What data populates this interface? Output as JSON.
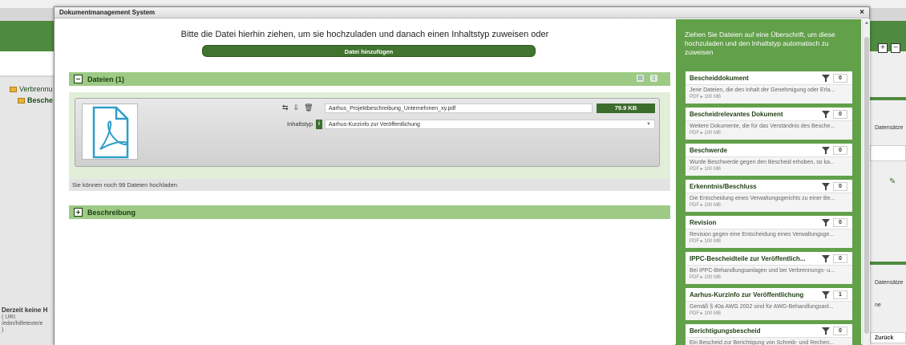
{
  "background": {
    "tree": [
      "Verbrennu",
      "Besche"
    ],
    "footer_title": "Derzeit keine H",
    "footer_lines": [
      "( URI:",
      "/edm/hilfetexte/e",
      ")"
    ],
    "right_labels": [
      "Datensätze",
      "Datensätze",
      "ne",
      "Zurück"
    ]
  },
  "dialog": {
    "title": "Dokumentmanagement System",
    "close": "×"
  },
  "upload": {
    "hint": "Bitte die Datei hierhin ziehen, um sie hochzuladen und danach einen Inhaltstyp zuweisen oder",
    "add_button": "Datei hinzufügen"
  },
  "files_section": {
    "title": "Dateien (1)",
    "file": {
      "name": "Aarhus_Projektbeschreibung_Unternehmen_xy.pdf",
      "size": "79.9 KB",
      "type_label": "Inhaltstyp",
      "type_badge": "i",
      "type_value": "Aarhus-Kurzinfo zur Veröffentlichung"
    },
    "remaining": "Sie können noch 99 Dateien hochladen"
  },
  "description_section": {
    "title": "Beschreibung"
  },
  "sidebar": {
    "hint": "Ziehen Sie Dateien auf eine Überschrift, um diese hochzuladen und den Inhaltstyp automatisch zu zuweisen",
    "items": [
      {
        "title": "Bescheiddokument",
        "count": "0",
        "desc": "Jene Dateien, die den Inhalt der Genehmigung oder Erla...",
        "meta": "PDF ▸ 100 MB"
      },
      {
        "title": "Bescheidrelevantes Dokument",
        "count": "0",
        "desc": "Weitere Dokumente, die für das Verständnis des Besche...",
        "meta": "PDF ▸ 100 MB"
      },
      {
        "title": "Beschwerde",
        "count": "0",
        "desc": "Wurde Beschwerde gegen den Bescheid erhoben, so ka...",
        "meta": "PDF ▸ 100 MB"
      },
      {
        "title": "Erkenntnis/Beschluss",
        "count": "0",
        "desc": "Die Entscheidung eines Verwaltungsgerichts zu einer Be...",
        "meta": "PDF ▸ 100 MB"
      },
      {
        "title": "Revision",
        "count": "0",
        "desc": "Revision gegen eine Entscheidung eines Verwaltungsge...",
        "meta": "PDF ▸ 100 MB"
      },
      {
        "title": "IPPC-Bescheidteile zur Veröffentlich...",
        "count": "0",
        "desc": "Bei IPPC-Behandlungsanlagen und bei Verbrennungs- u...",
        "meta": "PDF ▸ 100 MB"
      },
      {
        "title": "Aarhus-Kurzinfo zur Veröffentlichung",
        "count": "1",
        "desc": "Gemäß § 40a AWG 2002 sind für AWG-Behandlungsanl...",
        "meta": "PDF ▸ 100 MB"
      },
      {
        "title": "Berichtigungsbescheid",
        "count": "0",
        "desc": "Ein Bescheid zur Berichtigung von Schreib- und Rechen...",
        "meta": ""
      }
    ]
  },
  "colors": {
    "accent_green": "#62a04a",
    "dark_green": "#3d6d2c",
    "section_green": "#9dca85"
  }
}
